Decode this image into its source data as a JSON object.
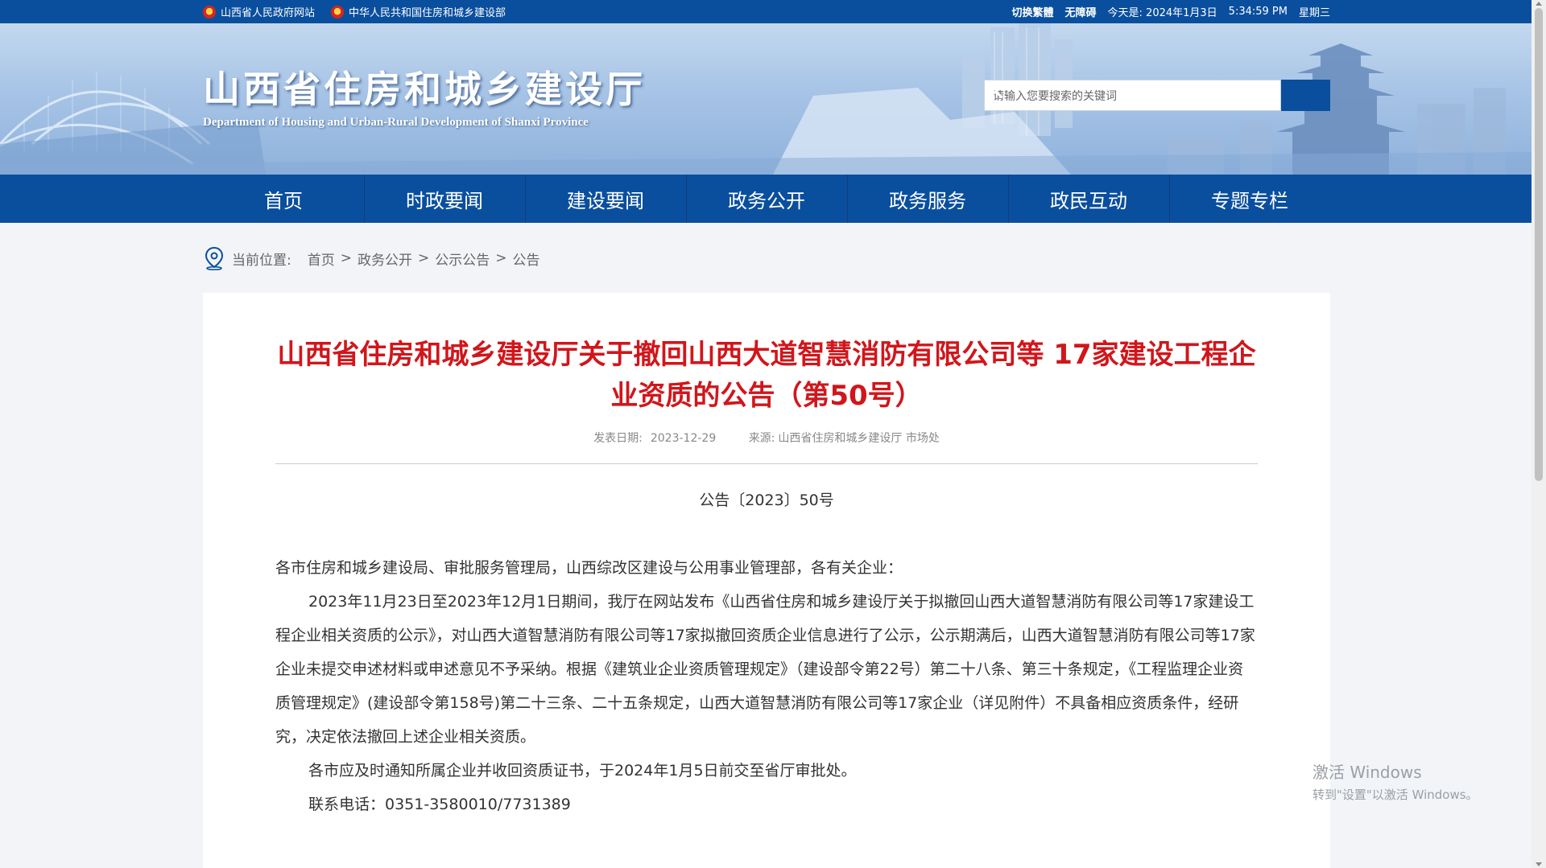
{
  "topbar": {
    "links": [
      {
        "label": "山西省人民政府网站"
      },
      {
        "label": "中华人民共和国住房和城乡建设部"
      }
    ],
    "switch_label": "切换繁體",
    "accessibility_label": "无障碍",
    "today_label": "今天是: 2024年1月3日",
    "time": "5:34:59 PM",
    "weekday": "星期三"
  },
  "header": {
    "title": "山西省住房和城乡建设厅",
    "subtitle": "Department of Housing and Urban-Rural Development of Shanxi Province",
    "search_placeholder": "请输入您要搜索的关键词",
    "search_icon": "magnifier"
  },
  "nav": {
    "items": [
      "首页",
      "时政要闻",
      "建设要闻",
      "政务公开",
      "政务服务",
      "政民互动",
      "专题专栏"
    ]
  },
  "breadcrumb": {
    "label": "当前位置:",
    "items": [
      "首页",
      "政务公开",
      "公示公告",
      "公告"
    ],
    "separator": ">"
  },
  "article": {
    "title": "山西省住房和城乡建设厅关于撤回山西大道智慧消防有限公司等 17家建设工程企业资质的公告（第50号）",
    "date_label": "发表日期:",
    "date": "2023-12-29",
    "source_label": "来源:",
    "source": "山西省住房和城乡建设厅 市场处",
    "doc_number": "公告〔2023〕50号",
    "salutation": "各市住房和城乡建设局、审批服务管理局，山西综改区建设与公用事业管理部，各有关企业：",
    "para1": "2023年11月23日至2023年12月1日期间，我厅在网站发布《山西省住房和城乡建设厅关于拟撤回山西大道智慧消防有限公司等17家建设工程企业相关资质的公示》，对山西大道智慧消防有限公司等17家拟撤回资质企业信息进行了公示，公示期满后，山西大道智慧消防有限公司等17家企业未提交申述材料或申述意见不予采纳。根据《建筑业企业资质管理规定》（建设部令第22号）第二十八条、第三十条规定，《工程监理企业资质管理规定》(建设部令第158号)第二十三条、二十五条规定，山西大道智慧消防有限公司等17家企业（详见附件）不具备相应资质条件，经研究，决定依法撤回上述企业相关资质。",
    "para2": "各市应及时通知所属企业并收回资质证书，于2024年1月5日前交至省厅审批处。",
    "para3": "联系电话：0351-3580010/7731389"
  },
  "watermark": {
    "line1": "激活 Windows",
    "line2": "转到\"设置\"以激活 Windows。"
  },
  "colors": {
    "primary": "#0a4f9e",
    "title_red": "#d1161b",
    "page_bg": "#f2f4f7"
  }
}
